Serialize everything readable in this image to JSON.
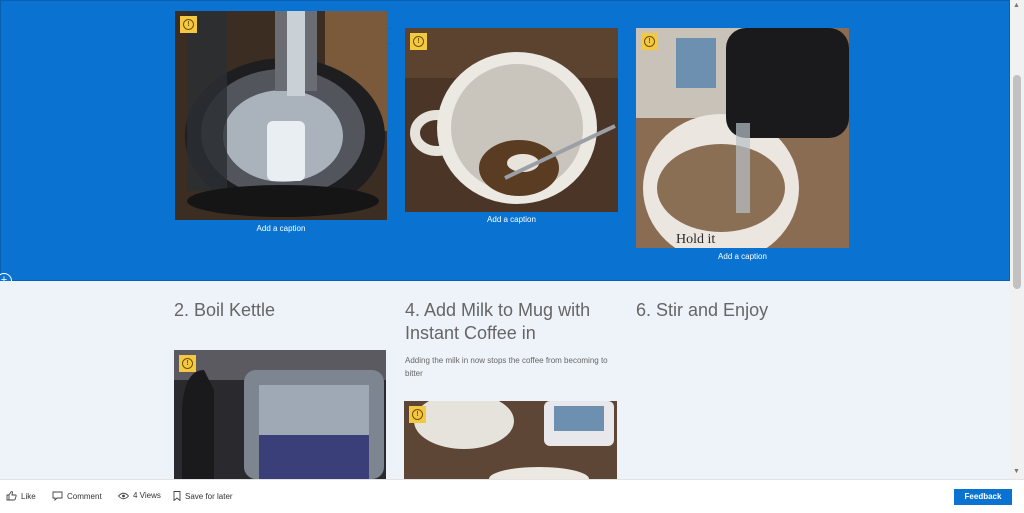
{
  "top_row": {
    "captions": [
      "Add a caption",
      "Add a caption",
      "Add a caption"
    ]
  },
  "steps": [
    {
      "title": "2. Boil Kettle",
      "description": ""
    },
    {
      "title": "4. Add Milk to Mug with Instant Coffee in",
      "description": "Adding the milk in now stops the coffee from becoming to bitter"
    },
    {
      "title": "6. Stir and Enjoy",
      "description": ""
    }
  ],
  "icons": {
    "image_info": "info-icon",
    "add_section": "plus-icon",
    "like": "thumbs-up-icon",
    "comment": "comment-icon",
    "views": "eye-icon",
    "save": "bookmark-icon"
  },
  "footer": {
    "like_label": "Like",
    "comment_label": "Comment",
    "views_label": "4 Views",
    "save_label": "Save for later",
    "feedback_label": "Feedback"
  },
  "colors": {
    "section_blue": "#0a73d1",
    "section_light": "#eef3fa",
    "badge_yellow": "#f5c842",
    "heading_gray": "#666666"
  }
}
